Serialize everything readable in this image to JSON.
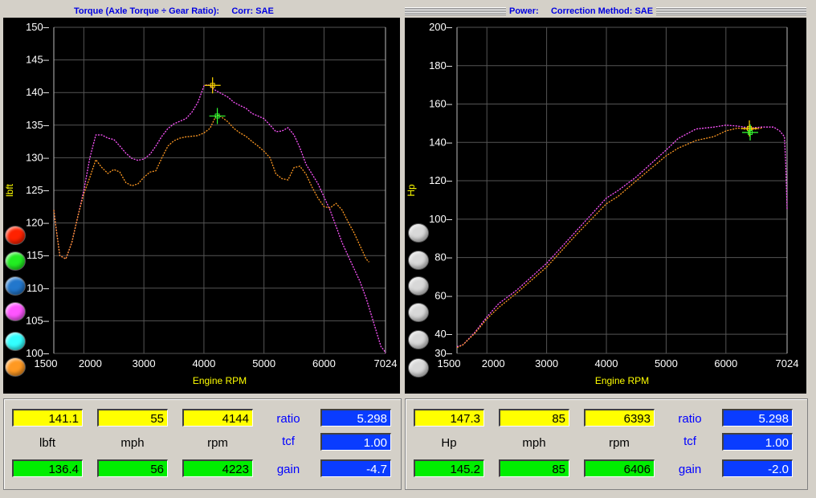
{
  "torque": {
    "title": "Torque (Axle Torque ÷ Gear Ratio):     Corr: SAE",
    "ylabel": "lbft",
    "xlabel": "Engine RPM",
    "yticks": [
      "150",
      "145",
      "140",
      "135",
      "130",
      "125",
      "120",
      "115",
      "110",
      "105",
      "100"
    ],
    "xticks": [
      "1500",
      "2000",
      "3000",
      "4000",
      "5000",
      "6000",
      "7024"
    ],
    "readout": {
      "top": [
        "141.1",
        "55",
        "4144"
      ],
      "units": [
        "lbft",
        "mph",
        "rpm"
      ],
      "bottom": [
        "136.4",
        "56",
        "4223"
      ],
      "side_labels": [
        "ratio",
        "tcf",
        "gain"
      ],
      "side_values": [
        "5.298",
        "1.00",
        "-4.7"
      ]
    }
  },
  "power": {
    "title": "Power:     Correction Method: SAE",
    "ylabel": "Hp",
    "xlabel": "Engine RPM",
    "yticks": [
      "200",
      "180",
      "160",
      "140",
      "120",
      "100",
      "80",
      "60",
      "40",
      "30"
    ],
    "xticks": [
      "1500",
      "2000",
      "3000",
      "4000",
      "5000",
      "6000",
      "7024"
    ],
    "readout": {
      "top": [
        "147.3",
        "85",
        "6393"
      ],
      "units": [
        "Hp",
        "mph",
        "rpm"
      ],
      "bottom": [
        "145.2",
        "85",
        "6406"
      ],
      "side_labels": [
        "ratio",
        "tcf",
        "gain"
      ],
      "side_values": [
        "5.298",
        "1.00",
        "-2.0"
      ]
    }
  },
  "colors": {
    "magenta_trace": "#ff55ff",
    "orange_trace": "#ff9922",
    "cursor_yellow": "#ffd700",
    "cursor_green": "#33ff33",
    "axis_label": "#ffff00",
    "dot_colors": [
      "#ff2200",
      "#22ee22",
      "#2277cc",
      "#ff55ff",
      "#33ffff",
      "#ff9922"
    ]
  },
  "chart_data": [
    {
      "type": "line",
      "xlabel": "Engine RPM",
      "ylabel": "lbft",
      "xlim": [
        1500,
        7024
      ],
      "ylim": [
        100,
        150
      ],
      "series": [
        {
          "color": "#ff55ff",
          "x": [
            1500,
            1540,
            1600,
            1700,
            1800,
            1900,
            2000,
            2100,
            2200,
            2300,
            2400,
            2500,
            2600,
            2700,
            2800,
            2900,
            3000,
            3100,
            3200,
            3300,
            3400,
            3500,
            3600,
            3700,
            3800,
            3900,
            4000,
            4050,
            4100,
            4150,
            4200,
            4300,
            4400,
            4500,
            4600,
            4700,
            4800,
            4900,
            5000,
            5100,
            5200,
            5300,
            5400,
            5500,
            5600,
            5700,
            5800,
            5900,
            6000,
            6100,
            6200,
            6300,
            6400,
            6500,
            6600,
            6700,
            6800,
            6900,
            6950,
            7000,
            7024
          ],
          "y": [
            122,
            119,
            115,
            114.5,
            117,
            121,
            125,
            130,
            133.5,
            133.5,
            133,
            132.8,
            131.8,
            130.7,
            129.9,
            129.6,
            129.8,
            130.5,
            131.8,
            133.3,
            134.5,
            135.2,
            135.6,
            136,
            137,
            138.5,
            141,
            141.2,
            141.1,
            140.6,
            140.3,
            139.8,
            139.3,
            138.5,
            138,
            137.6,
            136.8,
            136.4,
            136,
            135,
            134,
            134.1,
            134.6,
            133.5,
            131.5,
            129,
            127.5,
            126,
            124,
            122,
            119.5,
            117,
            115,
            113,
            111,
            108.5,
            105.5,
            102.5,
            101,
            100.5,
            100
          ]
        },
        {
          "color": "#ff9922",
          "x": [
            1500,
            1540,
            1600,
            1700,
            1800,
            1900,
            2000,
            2100,
            2200,
            2300,
            2400,
            2500,
            2600,
            2700,
            2800,
            2900,
            3000,
            3100,
            3200,
            3300,
            3400,
            3500,
            3600,
            3700,
            3800,
            3900,
            4000,
            4100,
            4200,
            4250,
            4300,
            4400,
            4500,
            4600,
            4700,
            4800,
            4900,
            5000,
            5100,
            5200,
            5300,
            5400,
            5500,
            5600,
            5700,
            5800,
            5900,
            6000,
            6100,
            6200,
            6300,
            6400,
            6500,
            6600,
            6700,
            6750
          ],
          "y": [
            122,
            119,
            115,
            114.5,
            117,
            121,
            124.5,
            127,
            129.7,
            128.5,
            127.6,
            128.2,
            127.8,
            126.2,
            125.7,
            126,
            127,
            127.8,
            128,
            130,
            131.8,
            132.6,
            133,
            133.2,
            133.3,
            133.4,
            133.8,
            134.5,
            136.4,
            136.5,
            136.2,
            135.5,
            134.5,
            133.8,
            133.3,
            132.5,
            131.8,
            131,
            130,
            127.5,
            126.8,
            126.6,
            128.5,
            128.7,
            127.5,
            125.5,
            123.8,
            122.5,
            122.3,
            123,
            122,
            120.2,
            118.5,
            116.5,
            114.5,
            114
          ]
        }
      ],
      "cursors": [
        {
          "color": "#ffd700",
          "x": 4144,
          "y": 141.1
        },
        {
          "color": "#33ff33",
          "x": 4223,
          "y": 136.4
        }
      ]
    },
    {
      "type": "line",
      "xlabel": "Engine RPM",
      "ylabel": "Hp",
      "xlim": [
        1500,
        7024
      ],
      "ylim": [
        30,
        200
      ],
      "series": [
        {
          "color": "#ff55ff",
          "x": [
            1500,
            1600,
            1800,
            2000,
            2200,
            2500,
            3000,
            3500,
            4000,
            4200,
            4500,
            5000,
            5200,
            5500,
            5800,
            6000,
            6200,
            6400,
            6600,
            6800,
            6900,
            6980,
            7000,
            7024
          ],
          "y": [
            33.5,
            34.5,
            41,
            49,
            56,
            63,
            77,
            94,
            111,
            115,
            122,
            136,
            142,
            147,
            148,
            149,
            148.5,
            147.5,
            148,
            148,
            146,
            143,
            130,
            105
          ]
        },
        {
          "color": "#ff9922",
          "x": [
            1500,
            1600,
            1800,
            2000,
            2200,
            2500,
            3000,
            3500,
            4000,
            4200,
            4500,
            5000,
            5200,
            5500,
            5800,
            6000,
            6200,
            6400,
            6500,
            6600
          ],
          "y": [
            33,
            34.5,
            40.5,
            48,
            54,
            61.5,
            75,
            92,
            108,
            112,
            120,
            133,
            137,
            141,
            143,
            146,
            147.5,
            146.5,
            147,
            147.5
          ]
        }
      ],
      "cursors": [
        {
          "color": "#ffd700",
          "x": 6393,
          "y": 147.3
        },
        {
          "color": "#33ff33",
          "x": 6406,
          "y": 145.2
        }
      ]
    }
  ]
}
